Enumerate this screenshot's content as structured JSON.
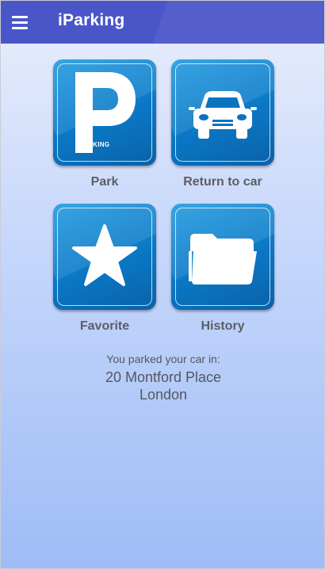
{
  "app": {
    "title": "iParking"
  },
  "icons": {
    "menu": "hamburger-menu-icon"
  },
  "tiles": [
    {
      "label": "Park",
      "icon": "parking-sign-icon",
      "icon_caption": "ARKING"
    },
    {
      "label": "Return to car",
      "icon": "car-icon"
    },
    {
      "label": "Favorite",
      "icon": "star-icon"
    },
    {
      "label": "History",
      "icon": "folder-icon"
    }
  ],
  "parked": {
    "label": "You parked your car in:",
    "street": "20 Montford Place",
    "city": "London"
  },
  "colors": {
    "app_bar": "#4a56c8",
    "tile_blue": "#0a78c6",
    "background_top": "#e9eefb",
    "background_bottom": "#9fbcf6",
    "label_text": "#5c5e66"
  }
}
